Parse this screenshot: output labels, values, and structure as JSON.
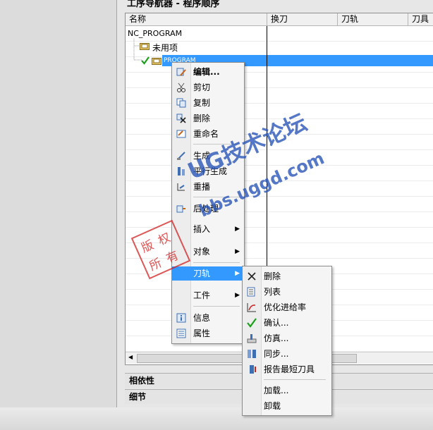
{
  "navigator": {
    "title": "工序导航器 - 程序顺序",
    "columns": [
      "名称",
      "换刀",
      "刀轨",
      "刀具"
    ],
    "tree": {
      "root": "NC_PROGRAM",
      "unused": "未用项",
      "program": "PROGRAM"
    }
  },
  "sections": {
    "dependencies": "相依性",
    "details": "细节"
  },
  "context_menu": {
    "items": [
      {
        "label": "编辑...",
        "icon": "edit-icon"
      },
      {
        "label": "剪切",
        "icon": "cut-icon"
      },
      {
        "label": "复制",
        "icon": "copy-icon"
      },
      {
        "label": "删除",
        "icon": "delete-icon"
      },
      {
        "label": "重命名",
        "icon": "rename-icon"
      },
      {
        "label": "生成",
        "icon": "generate-icon"
      },
      {
        "label": "平行生成",
        "icon": "parallel-generate-icon"
      },
      {
        "label": "重播",
        "icon": "replay-icon"
      },
      {
        "label": "后处理",
        "icon": "postprocess-icon"
      },
      {
        "label": "插入",
        "icon": ""
      },
      {
        "label": "对象",
        "icon": ""
      },
      {
        "label": "刀轨",
        "icon": ""
      },
      {
        "label": "工件",
        "icon": ""
      },
      {
        "label": "信息",
        "icon": "info-icon"
      },
      {
        "label": "属性",
        "icon": "properties-icon"
      }
    ]
  },
  "toolpath_submenu": {
    "items": [
      {
        "label": "删除",
        "icon": "toolpath-delete-icon"
      },
      {
        "label": "列表",
        "icon": "list-icon"
      },
      {
        "label": "优化进给率",
        "icon": "feedrate-icon"
      },
      {
        "label": "确认...",
        "icon": "verify-icon"
      },
      {
        "label": "仿真...",
        "icon": "simulate-icon"
      },
      {
        "label": "同步...",
        "icon": "sync-icon"
      },
      {
        "label": "报告最短刀具",
        "icon": "shortest-tool-icon"
      },
      {
        "label": "加载...",
        "icon": ""
      },
      {
        "label": "卸载",
        "icon": ""
      }
    ]
  },
  "watermark": {
    "line1": "UG技术论坛",
    "line2": "bbs.uggd.com",
    "stamp": [
      "版",
      "权",
      "所",
      "有"
    ]
  },
  "colors": {
    "selection": "#3399ff",
    "watermark": "#2a56b8",
    "stamp": "#d22020"
  }
}
